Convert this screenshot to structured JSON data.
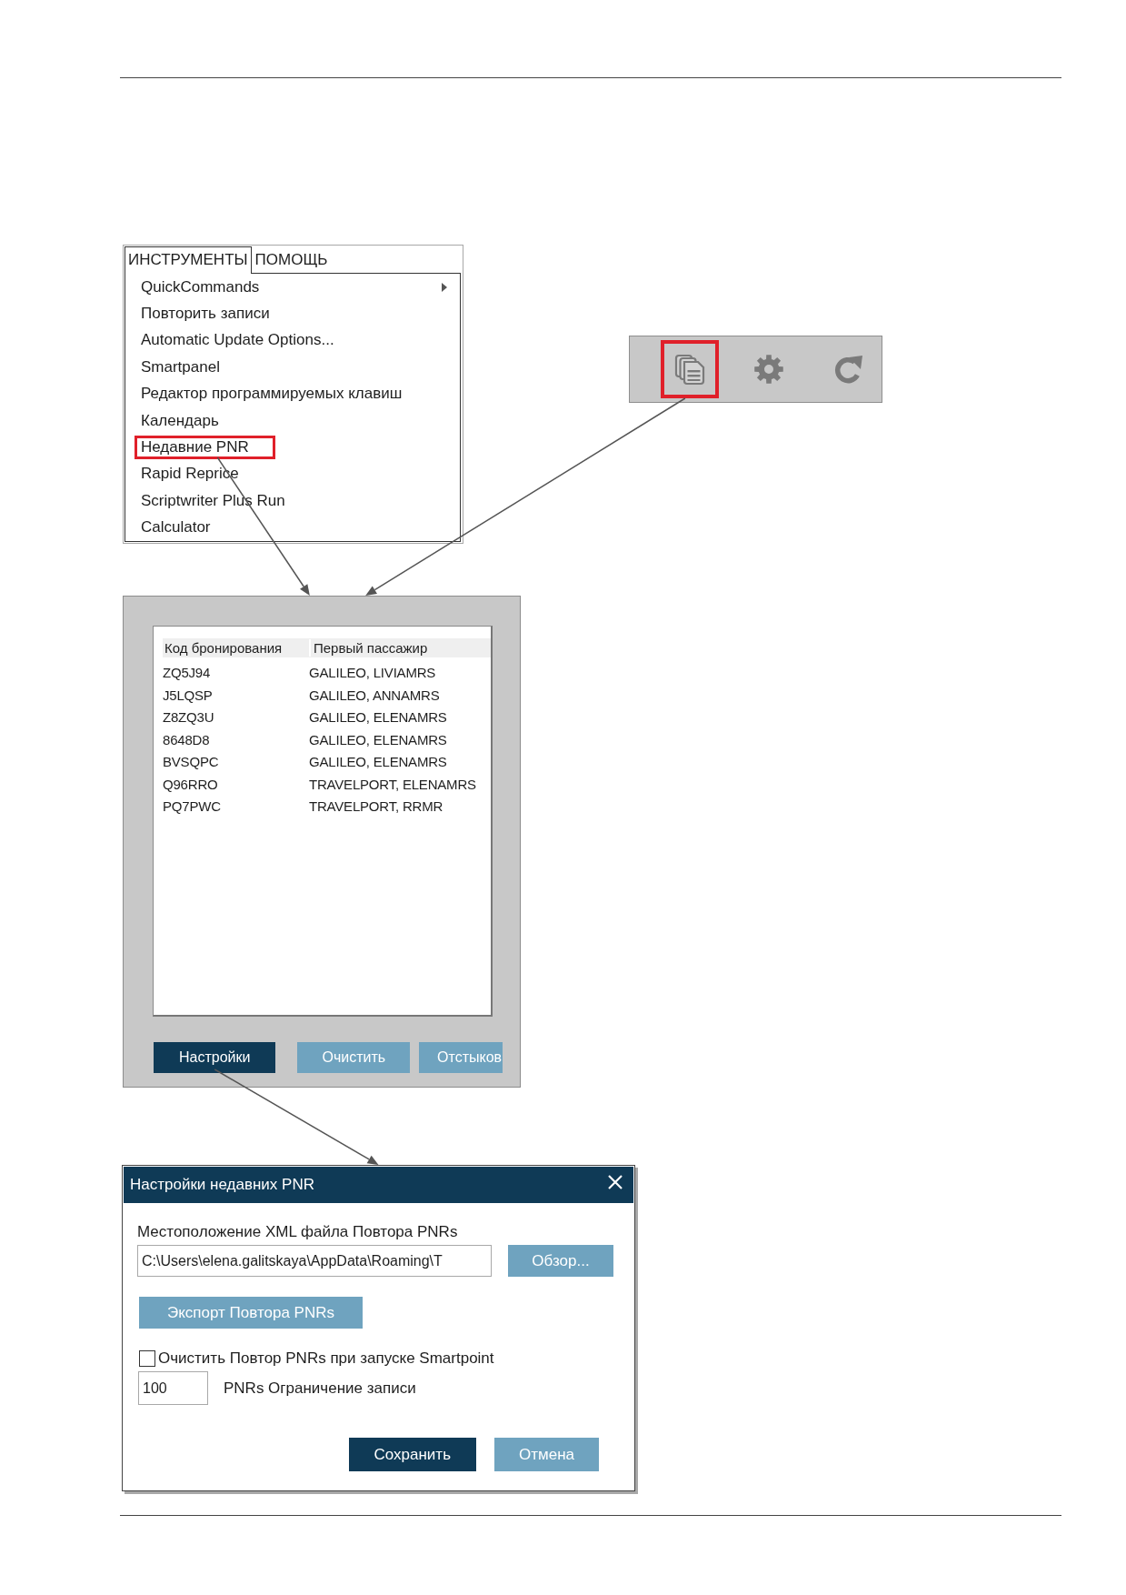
{
  "menu": {
    "tabs": [
      {
        "label": "ИНСТРУМЕНТЫ",
        "selected": true
      },
      {
        "label": "ПОМОЩЬ",
        "selected": false
      }
    ],
    "items": [
      {
        "label": "QuickCommands",
        "submenu": true,
        "highlighted": false
      },
      {
        "label": "Повторить записи",
        "submenu": false,
        "highlighted": false
      },
      {
        "label": "Automatic Update Options...",
        "submenu": false,
        "highlighted": false
      },
      {
        "label": "Smartpanel",
        "submenu": false,
        "highlighted": false
      },
      {
        "label": "Редактор программируемых клавиш",
        "submenu": false,
        "highlighted": false
      },
      {
        "label": "Календарь",
        "submenu": false,
        "highlighted": false
      },
      {
        "label": "Недавние PNR",
        "submenu": false,
        "highlighted": true
      },
      {
        "label": "Rapid Reprice",
        "submenu": false,
        "highlighted": false
      },
      {
        "label": "Scriptwriter Plus Run",
        "submenu": false,
        "highlighted": false
      },
      {
        "label": "Calculator",
        "submenu": false,
        "highlighted": false
      }
    ]
  },
  "toolbar": {
    "buttons": [
      {
        "kind": "copy",
        "highlighted": true
      },
      {
        "kind": "settings",
        "highlighted": false
      },
      {
        "kind": "refresh",
        "highlighted": false
      }
    ]
  },
  "recent_pnr_panel": {
    "table": {
      "columns": [
        "Код бронирования",
        "Первый пассажир"
      ],
      "rows": [
        [
          "ZQ5J94",
          "GALILEO, LIVIAMRS"
        ],
        [
          "J5LQSP",
          "GALILEO, ANNAMRS"
        ],
        [
          "Z8ZQ3U",
          "GALILEO, ELENAMRS"
        ],
        [
          "8648D8",
          "GALILEO, ELENAMRS"
        ],
        [
          "BVSQPC",
          "GALILEO, ELENAMRS"
        ],
        [
          "Q96RRO",
          "TRAVELPORT, ELENAMRS"
        ],
        [
          "PQ7PWC",
          "TRAVELPORT, RRMR"
        ]
      ]
    },
    "buttons": [
      {
        "label": "Настройки",
        "primary": true
      },
      {
        "label": "Очистить",
        "primary": false
      },
      {
        "label": "Отстыков",
        "primary": false
      }
    ]
  },
  "settings_dialog": {
    "title": "Настройки недавних PNR",
    "location": {
      "label": "Местоположение XML файла Повтора PNRs",
      "value": "C:\\Users\\elena.galitskaya\\AppData\\Roaming\\T"
    },
    "browse_button": "Обзор...",
    "export_button": "Экспорт Повтора PNRs",
    "clear_on_start": {
      "label": "Очистить Повтор PNRs при запуске Smartpoint",
      "checked": false
    },
    "record_limit": {
      "value": "100",
      "label": "PNRs Ограничение записи"
    },
    "buttons": [
      {
        "label": "Сохранить",
        "primary": true
      },
      {
        "label": "Отмена",
        "primary": false
      }
    ]
  }
}
